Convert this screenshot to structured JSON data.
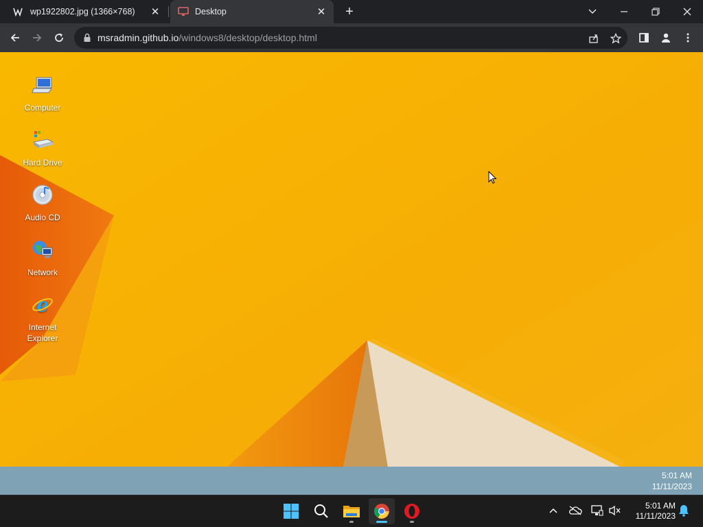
{
  "browser": {
    "tabs": [
      {
        "title": "wp1922802.jpg (1366×768)",
        "favicon": "w-icon",
        "active": false
      },
      {
        "title": "Desktop",
        "favicon": "monitor-icon",
        "active": true
      }
    ],
    "url": {
      "host": "msradmin.github.io",
      "path": "/windows8/desktop/desktop.html"
    },
    "colors": {
      "tabstrip": "#202124",
      "toolbar": "#35363a",
      "active_tab_favicon": "#e06666"
    }
  },
  "desktop": {
    "icons": [
      {
        "label": "Computer",
        "icon": "computer-icon"
      },
      {
        "label": "Hard Drive",
        "icon": "hard-drive-icon"
      },
      {
        "label": "Audio CD",
        "icon": "audio-cd-icon"
      },
      {
        "label": "Network",
        "icon": "network-icon"
      },
      {
        "label": "Internet Explorer",
        "icon": "internet-explorer-icon"
      }
    ],
    "taskbar": {
      "time": "5:01 AM",
      "date": "11/11/2023"
    },
    "colors": {
      "wallpaper": "#f7b400",
      "accent_orange": "#ea6a0a",
      "taskbar": "#6ea0cd"
    }
  },
  "os_taskbar": {
    "apps": [
      {
        "name": "windows-start-icon",
        "active": false,
        "running": false
      },
      {
        "name": "search-icon",
        "active": false,
        "running": false
      },
      {
        "name": "file-explorer-icon",
        "active": false,
        "running": true
      },
      {
        "name": "chrome-icon",
        "active": true,
        "running": true
      },
      {
        "name": "opera-icon",
        "active": false,
        "running": true
      }
    ],
    "tray": {
      "time": "5:01 AM",
      "date": "11/11/2023"
    }
  }
}
